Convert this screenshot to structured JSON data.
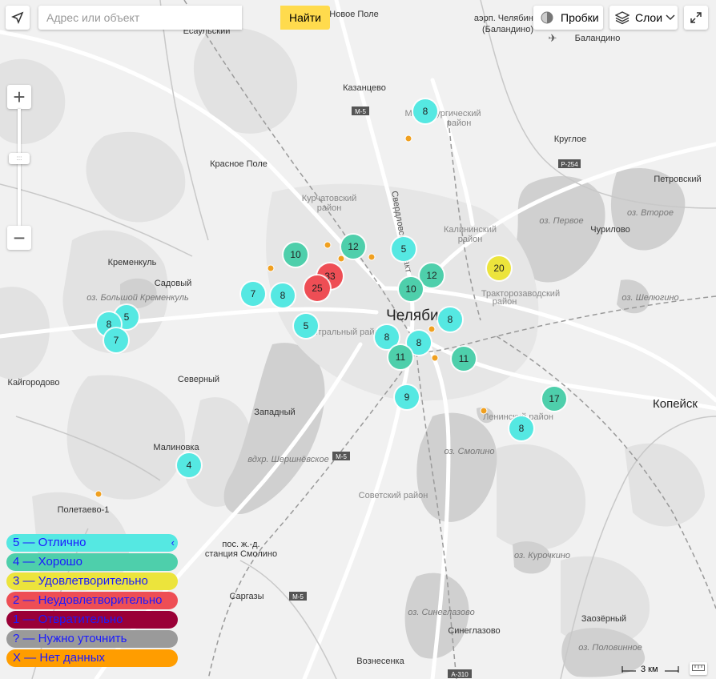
{
  "search": {
    "placeholder": "Адрес или объект",
    "button_label": "Найти"
  },
  "controls": {
    "traffic_label": "Пробки",
    "layers_label": "Слои",
    "zoom_in": "+",
    "zoom_out": "−"
  },
  "map_labels": {
    "city": "Челябинск",
    "kopeisk": "Копейск",
    "novoe_pole": "Новое Поле",
    "airport": "аэрп. Челябинск",
    "airport_sub": "(Баландино)",
    "balandino": "Баландино",
    "esaulsky": "Есаульский",
    "kazantsevo": "Казанцево",
    "m5_a": "M-5",
    "m5_b": "M-5",
    "m5_c": "M-5",
    "metallurg": "Металлургический",
    "metallurg2": "район",
    "kurchatov": "Курчатовский",
    "kurchatov2": "район",
    "kalinin": "Калининский",
    "kalinin2": "район",
    "traktor": "Тракторозаводский",
    "traktor2": "район",
    "central": "Центральный район",
    "leninsky": "Ленинский район",
    "sovetsky": "Советский район",
    "krasnoe_pole": "Красное Поле",
    "sverdlov": "Свердловский тракт",
    "krugloe": "Круглое",
    "r254": "P-254",
    "petrovsky": "Петровский",
    "oz_pervoe": "оз. Первое",
    "oz_vtoroe": "оз. Второе",
    "churilovo": "Чурилово",
    "oz_sheluginо": "оз. Шелюгино",
    "kremenkul": "Кременкуль",
    "sadovy": "Садовый",
    "oz_kremenkul": "оз. Большой Кременкуль",
    "kaigorodovo": "Кайгородово",
    "severny": "Северный",
    "zapadny": "Западный",
    "malinovka": "Малиновка",
    "vdhr": "вдхр. Шершнёвское",
    "oz_smolino": "оз. Смолино",
    "poletaevo": "Полетаево-1",
    "smolino_st1": "пос. ж.-д.",
    "smolino_st2": "станция Смолино",
    "sargazy": "Саргазы",
    "oz_kurochkino": "оз. Курочкино",
    "oz_sineglazovo": "оз. Синеглазово",
    "sineglazovo": "Синеглазово",
    "zaozerny": "Заозёрный",
    "oz_polovinnoe": "оз. Половинное",
    "voznesenka": "Вознесенка",
    "a310": "A-310"
  },
  "clusters": [
    {
      "label": "8",
      "status": "good-5"
    },
    {
      "label": "12",
      "status": "good-4"
    },
    {
      "label": "10",
      "status": "good-4"
    },
    {
      "label": "5",
      "status": "good-5"
    },
    {
      "label": "33",
      "status": "bad-2"
    },
    {
      "label": "25",
      "status": "bad-2"
    },
    {
      "label": "12",
      "status": "good-4"
    },
    {
      "label": "10",
      "status": "good-4"
    },
    {
      "label": "20",
      "status": "ok-3"
    },
    {
      "label": "7",
      "status": "good-5"
    },
    {
      "label": "8",
      "status": "good-5"
    },
    {
      "label": "5",
      "status": "good-5"
    },
    {
      "label": "5",
      "status": "good-5"
    },
    {
      "label": "8",
      "status": "good-5"
    },
    {
      "label": "7",
      "status": "good-5"
    },
    {
      "label": "8",
      "status": "good-5"
    },
    {
      "label": "8",
      "status": "good-5"
    },
    {
      "label": "8",
      "status": "good-5"
    },
    {
      "label": "11",
      "status": "good-4"
    },
    {
      "label": "11",
      "status": "good-4"
    },
    {
      "label": "9",
      "status": "good-5"
    },
    {
      "label": "17",
      "status": "good-4"
    },
    {
      "label": "8",
      "status": "good-5"
    },
    {
      "label": "4",
      "status": "good-5"
    }
  ],
  "legend": [
    {
      "label": "5 — Отлично",
      "color": "#55e8e2"
    },
    {
      "label": "4 — Хорошо",
      "color": "#4ecfab"
    },
    {
      "label": "3 — Удовлетворительно",
      "color": "#ece43c"
    },
    {
      "label": "2 — Неудовлетворительно",
      "color": "#ee4e55"
    },
    {
      "label": "1 — Отвратительно",
      "color": "#9a0037"
    },
    {
      "label": "? — Нужно уточнить",
      "color": "#9a9a9a"
    },
    {
      "label": "X — Нет данных",
      "color": "#ff9d00"
    }
  ],
  "legend_collapse_icon": "‹",
  "scale_label": "3 км",
  "colors": {
    "excellent": "#55e8e2",
    "good": "#4ecfab",
    "ok": "#ece43c",
    "bad": "#ee4e55",
    "nodata": "#f0a020",
    "search_button": "#ffdb4d"
  }
}
